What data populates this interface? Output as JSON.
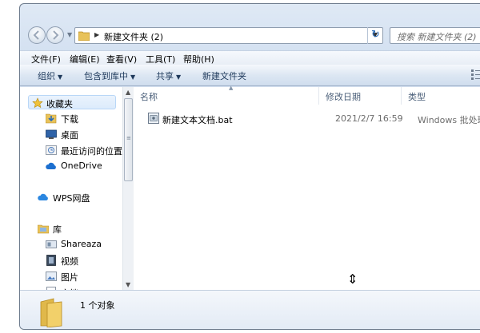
{
  "address": {
    "path": "新建文件夹 (2)"
  },
  "search": {
    "placeholder": "搜索 新建文件夹 (2)"
  },
  "menu": [
    "文件(F)",
    "编辑(E)",
    "查看(V)",
    "工具(T)",
    "帮助(H)"
  ],
  "toolbar": {
    "organize": "组织",
    "include_in_library": "包含到库中",
    "share": "共享",
    "new_folder": "新建文件夹"
  },
  "nav": {
    "favorites": "收藏夹",
    "downloads": "下载",
    "desktop": "桌面",
    "recent": "最近访问的位置",
    "onedrive": "OneDrive",
    "wps": "WPS网盘",
    "library": "库",
    "shareaza": "Shareaza",
    "videos": "视频",
    "pictures": "图片",
    "documents": "文档"
  },
  "columns": {
    "name": "名称",
    "modified": "修改日期",
    "type": "类型"
  },
  "files": [
    {
      "name": "新建文本文档.bat",
      "modified": "2021/2/7 16:59",
      "type": "Windows 批处理..."
    }
  ],
  "details": {
    "item_count": "1 个对象"
  },
  "colors": {
    "window_bg": "#d4e1f1",
    "selection": "#dcebfc",
    "accent": "#2a6bb6"
  },
  "icons": [
    "back-icon",
    "forward-icon",
    "folder-icon",
    "refresh-icon",
    "star-icon",
    "download-icon",
    "desktop-icon",
    "recent-icon",
    "cloud-icon",
    "library-icon",
    "video-icon",
    "picture-icon",
    "document-icon",
    "bat-file-icon",
    "resize-cursor-icon"
  ]
}
